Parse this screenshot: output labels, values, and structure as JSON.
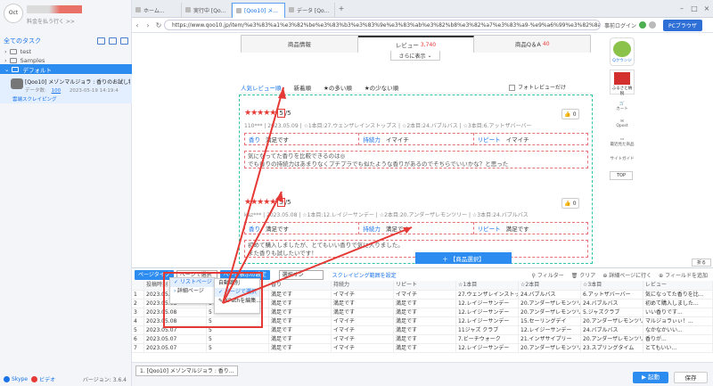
{
  "sidebar": {
    "subtitle": "料金を払う行く >>",
    "all_tasks": "全てのタスク",
    "tree": [
      "test",
      "Samples",
      "デフォルト"
    ],
    "task": {
      "title": "[Qoo10] メゾンマルジョラ : 香りのお試し特...",
      "meta_label": "データ数:",
      "meta_count": "100",
      "meta_date": "2023-05-19 14:19:4",
      "cloud": "雲端スクレイピング"
    },
    "footer": {
      "skype": "Skype",
      "video": "ビデオ",
      "version": "バージョン: 3.6.4"
    }
  },
  "browser": {
    "tabs": [
      "ホーム...",
      "実行中 [Qo...",
      "[Qoo10] メ...",
      "データ [Qo..."
    ],
    "active_tab": 2,
    "url": "https://www.qoo10.jp/item/%e3%83%a1%e3%82%be%e3%83%b3%e3%83%9e%e3%83%ab%e3%82%b8%e3%82%a7%e3%83%a9-%e9%a6%99%e3%82%8a",
    "login": "事前ログイン",
    "pc_button": "PCブラウザ"
  },
  "page": {
    "tabs": [
      {
        "label": "商品情報",
        "count": ""
      },
      {
        "label": "レビュー",
        "count": "3,740"
      },
      {
        "label": "商品Q＆A",
        "count": "40"
      }
    ],
    "more": "さらに表示",
    "filters": [
      "人気レビュー順",
      "新着順",
      "★の多い順",
      "★の少ない順"
    ],
    "photo_only": "フォトレビューだけ",
    "reviews": [
      {
        "stars": "★★★★★",
        "score": "5",
        "total": "/5",
        "meta": "110*** | 2023.05.09 | ☆1本目:27.ウェンザレインストップス | ☆2本目:24.バブルバス | ☆3本目:6.アットザバーバー",
        "likes": "0",
        "attrs": [
          {
            "k": "香り",
            "v": "満足です"
          },
          {
            "k": "持続力",
            "v": "イマイチ"
          },
          {
            "k": "リピート",
            "v": "イマイチ"
          }
        ],
        "text1": "気になってた香りを比較できるのは◎",
        "text2": "でも香りの持続力はあまりなくプチプラでも似たような香りがあるのでそちらでいいかな？と思った"
      },
      {
        "stars": "★★★★★",
        "score": "5",
        "total": "/5",
        "meta": "kaz*** | 2023.05.08 | ☆1本目:12.レイジーサンデー | ☆2本目:20.アンダーザレモンツリー | ☆3本目:24.バブルバス",
        "likes": "0",
        "attrs": [
          {
            "k": "香り",
            "v": "満足です"
          },
          {
            "k": "持続力",
            "v": "満足です"
          },
          {
            "k": "リピート",
            "v": "満足です"
          }
        ],
        "text1": "初めて購入しましたが、とてもいい香りで気に入りました。",
        "text2": "また香りも試したいです！"
      }
    ],
    "widgets": {
      "app": "Qクウンジ",
      "furusato": "ふるさと納税",
      "cart": "カート",
      "coupon": "Qpost",
      "recent": "最近見た商品",
      "guide": "サイトガイド",
      "top": "TOP"
    },
    "select_bar": "【商品選択】",
    "fold": "折る"
  },
  "toolbar": {
    "page_type": "ページタイプ",
    "page_select": "ページで選択",
    "page_setting": "ページ表示の設定",
    "select_placeholder": "選択オン",
    "scrape_link": "スクレイピング範囲を設定",
    "filter": "フィルター",
    "clear": "クリア",
    "detail": "詳細ページに行く",
    "add_field": "フィールドを追加"
  },
  "dropdown1": [
    "リストページ",
    "詳細ページ"
  ],
  "dropdown2": [
    "自動識別",
    "ページで選択",
    "XPathを編集..."
  ],
  "grid": {
    "headers": [
      "",
      "投稿時刻",
      "",
      "香り",
      "持続力",
      "リピート",
      "☆1本目",
      "☆2本目",
      "☆3本目",
      "レビュー"
    ],
    "rows": [
      [
        "1",
        "2023.05.09",
        "5",
        "満足です",
        "イマイチ",
        "イマイチ",
        "27.ウェンザレインストップ...",
        "24.バブルバス",
        "6.アットザバーバー",
        "気になってた香りを比..."
      ],
      [
        "2",
        "2023.05.08",
        "5",
        "満足です",
        "満足です",
        "満足です",
        "12.レイジーサンデー",
        "20.アンダーザレモンツリー",
        "24.バブルバス",
        "初めて購入しました..."
      ],
      [
        "3",
        "2023.05.08",
        "5",
        "満足です",
        "満足です",
        "満足です",
        "12.レイジーサンデー",
        "20.アンダーザレモンツリー",
        "5.ジャズクラブ",
        "いい香りです..."
      ],
      [
        "4",
        "2023.05.08",
        "5",
        "満足です",
        "イマイチ",
        "満足です",
        "12.レイジーサンデー",
        "15.セーリングデイ",
        "20.アンダーザレモンツリー",
        "マルジョラぃぃ！..."
      ],
      [
        "5",
        "2023.05.07",
        "5",
        "満足です",
        "イマイチ",
        "満足です",
        "11ジャズ クラブ",
        "12.レイジーサンデー",
        "24.バブルバス",
        "なかなかいい..."
      ],
      [
        "6",
        "2023.05.07",
        "5",
        "満足です",
        "イマイチ",
        "満足です",
        "7.ビーチウォーク",
        "21.インザサイプリー",
        "20.アンダーザレモンツリー",
        "香りが..."
      ],
      [
        "7",
        "2023.05.07",
        "5",
        "満足です",
        "イマイチ",
        "満足です",
        "12.レイジーサンデー",
        "20.アンダーザレモンツリー",
        "23.スプリングタイム",
        "とてもいい..."
      ]
    ]
  },
  "footer": {
    "task_tab": "1. [Qoo10] メゾンマルジョラ : 香り...",
    "run": "▶ 起動",
    "save": "保存"
  }
}
